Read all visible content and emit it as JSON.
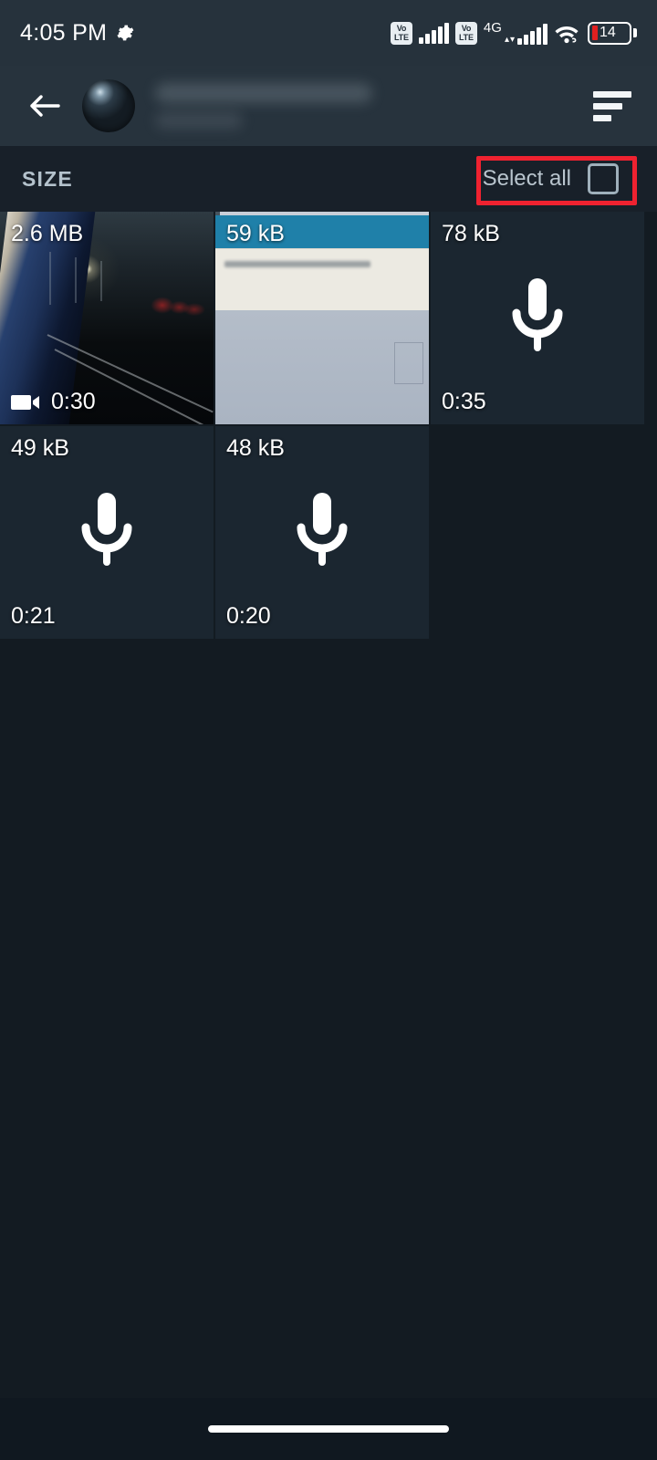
{
  "status_bar": {
    "time": "4:05 PM",
    "gear_icon": "gear-icon",
    "volte_top": "Vo",
    "volte_bottom": "LTE",
    "network_type": "4G",
    "upload_arrow": "▴",
    "download_arrow": "▾",
    "wifi_icon": "wifi-linked-icon",
    "battery_level": "14"
  },
  "app_bar": {
    "back_icon": "back-arrow-icon",
    "avatar": "contact-avatar",
    "title": "",
    "subtitle": "",
    "sort_icon": "sort-icon"
  },
  "section": {
    "size_label": "SIZE",
    "select_all_label": "Select all",
    "checkbox_state": "unchecked",
    "annotation_color": "#ef2230"
  },
  "media_grid": {
    "items": [
      {
        "size": "2.6 MB",
        "duration": "0:30",
        "type": "video",
        "icon": "video-camera-icon"
      },
      {
        "size": "59 kB",
        "duration": "",
        "type": "image",
        "icon": ""
      },
      {
        "size": "78 kB",
        "duration": "0:35",
        "type": "audio",
        "icon": "microphone-icon"
      },
      {
        "size": "49 kB",
        "duration": "0:21",
        "type": "audio",
        "icon": "microphone-icon"
      },
      {
        "size": "48 kB",
        "duration": "0:20",
        "type": "audio",
        "icon": "microphone-icon"
      }
    ]
  },
  "nav": {
    "home_pill": "home-gesture-pill"
  },
  "colors": {
    "page_background": "#131b22",
    "status_bar_background": "#26323c",
    "app_bar_background": "#27333d",
    "section_background": "#182029",
    "tile_background": "#1b2630",
    "accent_red": "#ef2230",
    "text_primary": "#ffffff",
    "text_secondary": "#b4c2cc"
  }
}
